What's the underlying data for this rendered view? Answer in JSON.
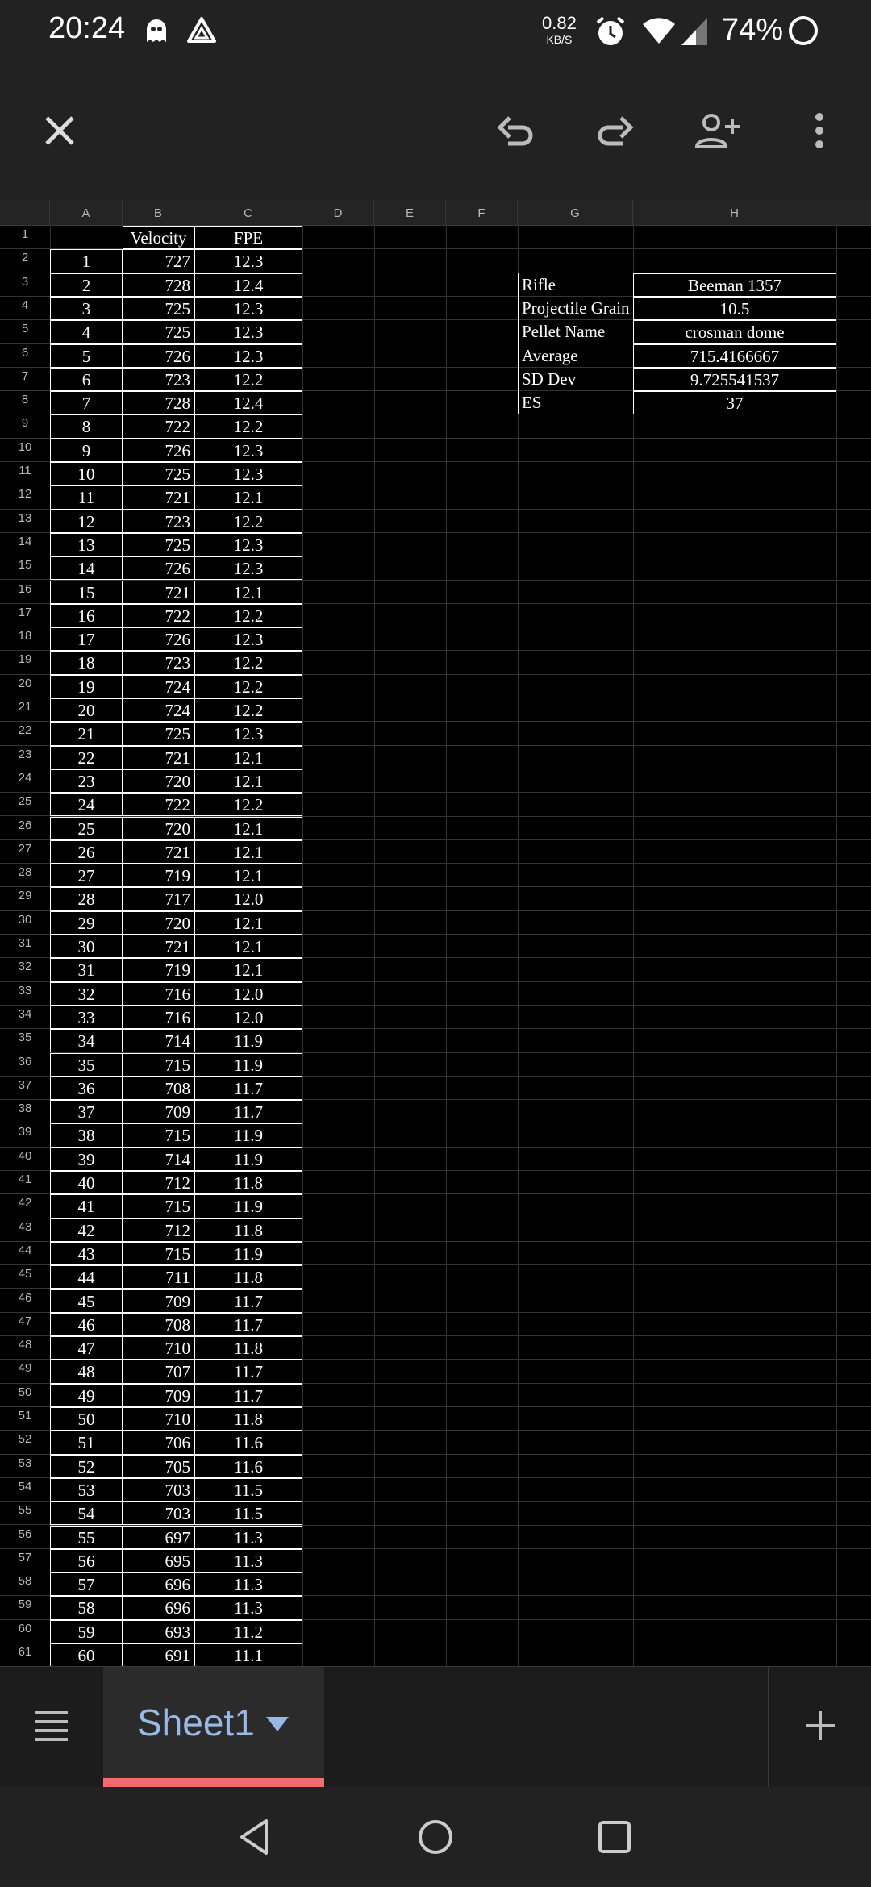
{
  "status_bar": {
    "time": "20:24",
    "net_speed_value": "0.82",
    "net_speed_unit": "KB/S",
    "battery": "74%"
  },
  "toolbar": {
    "close_icon": "close-icon",
    "undo_icon": "undo-icon",
    "redo_icon": "redo-icon",
    "share_icon": "add-person-icon",
    "more_icon": "more-vert-icon"
  },
  "columns": [
    "A",
    "B",
    "C",
    "D",
    "E",
    "F",
    "G",
    "H"
  ],
  "rows": [
    "1",
    "2",
    "3",
    "4",
    "5",
    "6",
    "7",
    "8",
    "9",
    "10",
    "11",
    "12",
    "13",
    "14",
    "15",
    "16",
    "17",
    "18",
    "19",
    "20",
    "21",
    "22",
    "23",
    "24",
    "25",
    "26",
    "27",
    "28",
    "29",
    "30",
    "31",
    "32",
    "33",
    "34",
    "35",
    "36",
    "37",
    "38",
    "39",
    "40",
    "41",
    "42",
    "43",
    "44",
    "45",
    "46",
    "47",
    "48",
    "49",
    "50",
    "51",
    "52",
    "53",
    "54",
    "55",
    "56",
    "57",
    "58",
    "59",
    "60",
    "61"
  ],
  "table_headers": {
    "B": "Velocity",
    "C": "FPE"
  },
  "shots": [
    [
      "1",
      "727",
      "12.3"
    ],
    [
      "2",
      "728",
      "12.4"
    ],
    [
      "3",
      "725",
      "12.3"
    ],
    [
      "4",
      "725",
      "12.3"
    ],
    [
      "5",
      "726",
      "12.3"
    ],
    [
      "6",
      "723",
      "12.2"
    ],
    [
      "7",
      "728",
      "12.4"
    ],
    [
      "8",
      "722",
      "12.2"
    ],
    [
      "9",
      "726",
      "12.3"
    ],
    [
      "10",
      "725",
      "12.3"
    ],
    [
      "11",
      "721",
      "12.1"
    ],
    [
      "12",
      "723",
      "12.2"
    ],
    [
      "13",
      "725",
      "12.3"
    ],
    [
      "14",
      "726",
      "12.3"
    ],
    [
      "15",
      "721",
      "12.1"
    ],
    [
      "16",
      "722",
      "12.2"
    ],
    [
      "17",
      "726",
      "12.3"
    ],
    [
      "18",
      "723",
      "12.2"
    ],
    [
      "19",
      "724",
      "12.2"
    ],
    [
      "20",
      "724",
      "12.2"
    ],
    [
      "21",
      "725",
      "12.3"
    ],
    [
      "22",
      "721",
      "12.1"
    ],
    [
      "23",
      "720",
      "12.1"
    ],
    [
      "24",
      "722",
      "12.2"
    ],
    [
      "25",
      "720",
      "12.1"
    ],
    [
      "26",
      "721",
      "12.1"
    ],
    [
      "27",
      "719",
      "12.1"
    ],
    [
      "28",
      "717",
      "12.0"
    ],
    [
      "29",
      "720",
      "12.1"
    ],
    [
      "30",
      "721",
      "12.1"
    ],
    [
      "31",
      "719",
      "12.1"
    ],
    [
      "32",
      "716",
      "12.0"
    ],
    [
      "33",
      "716",
      "12.0"
    ],
    [
      "34",
      "714",
      "11.9"
    ],
    [
      "35",
      "715",
      "11.9"
    ],
    [
      "36",
      "708",
      "11.7"
    ],
    [
      "37",
      "709",
      "11.7"
    ],
    [
      "38",
      "715",
      "11.9"
    ],
    [
      "39",
      "714",
      "11.9"
    ],
    [
      "40",
      "712",
      "11.8"
    ],
    [
      "41",
      "715",
      "11.9"
    ],
    [
      "42",
      "712",
      "11.8"
    ],
    [
      "43",
      "715",
      "11.9"
    ],
    [
      "44",
      "711",
      "11.8"
    ],
    [
      "45",
      "709",
      "11.7"
    ],
    [
      "46",
      "708",
      "11.7"
    ],
    [
      "47",
      "710",
      "11.8"
    ],
    [
      "48",
      "707",
      "11.7"
    ],
    [
      "49",
      "709",
      "11.7"
    ],
    [
      "50",
      "710",
      "11.8"
    ],
    [
      "51",
      "706",
      "11.6"
    ],
    [
      "52",
      "705",
      "11.6"
    ],
    [
      "53",
      "703",
      "11.5"
    ],
    [
      "54",
      "703",
      "11.5"
    ],
    [
      "55",
      "697",
      "11.3"
    ],
    [
      "56",
      "695",
      "11.3"
    ],
    [
      "57",
      "696",
      "11.3"
    ],
    [
      "58",
      "696",
      "11.3"
    ],
    [
      "59",
      "693",
      "11.2"
    ],
    [
      "60",
      "691",
      "11.1"
    ]
  ],
  "summary": [
    {
      "label": "Rifle",
      "value": "Beeman 1357"
    },
    {
      "label": "Projectile Grain",
      "value": "10.5"
    },
    {
      "label": "Pellet Name",
      "value": "crosman dome"
    },
    {
      "label": "Average",
      "value": "715.4166667"
    },
    {
      "label": "SD Dev",
      "value": "9.725541537"
    },
    {
      "label": "ES",
      "value": "37"
    }
  ],
  "sheet_tabs": {
    "menu_icon": "sheet-list-icon",
    "active": "Sheet1",
    "add_icon": "plus-icon"
  },
  "nav_bar": {
    "back_icon": "back-icon",
    "home_icon": "home-icon",
    "recents_icon": "recents-icon"
  }
}
